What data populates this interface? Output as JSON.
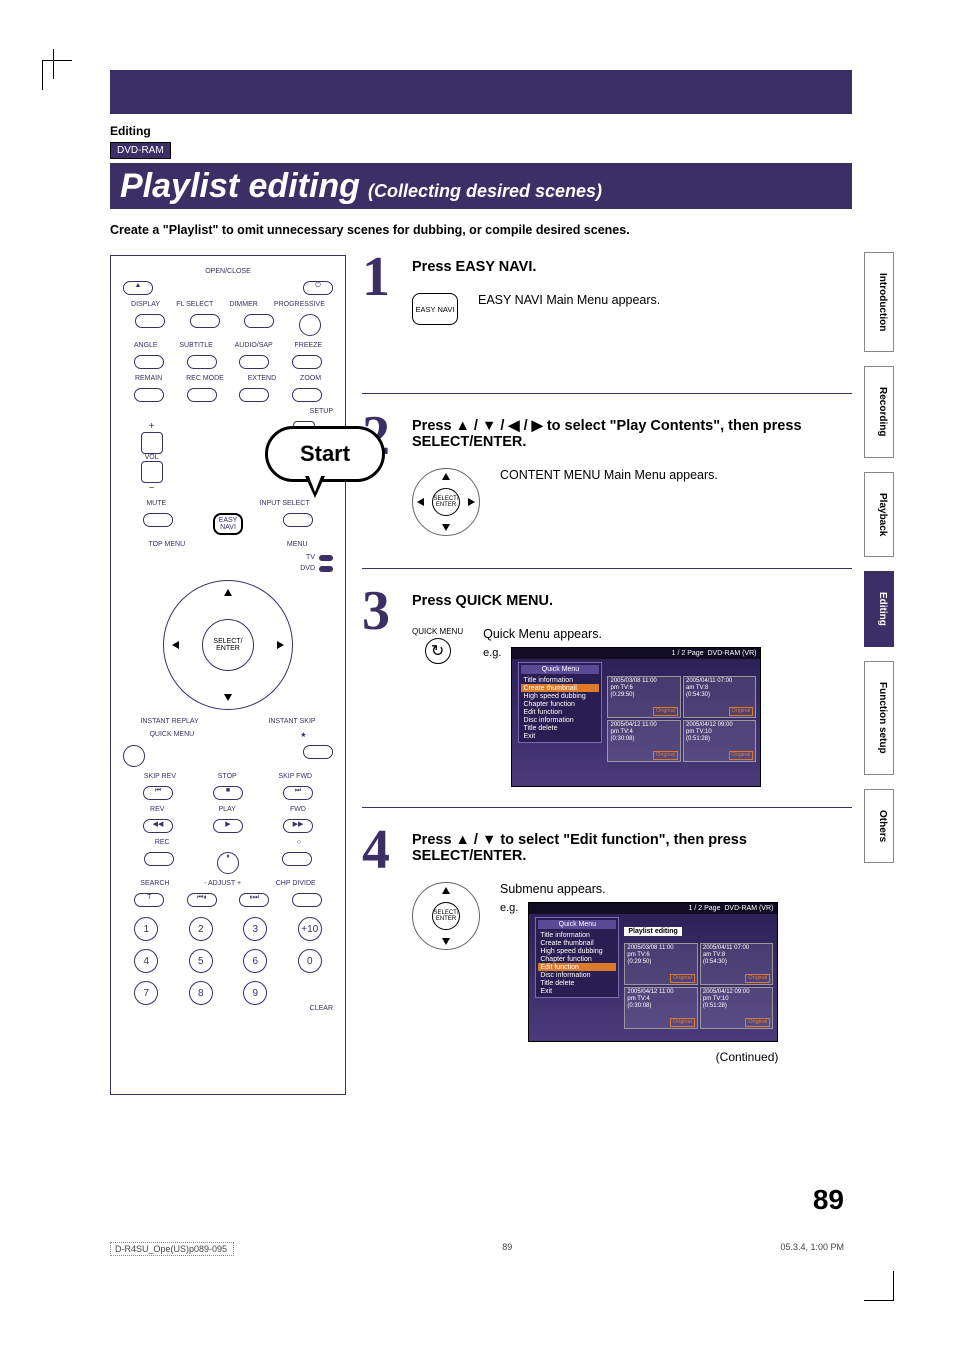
{
  "header": {
    "section": "Editing",
    "disc_type": "DVD-RAM",
    "title": "Playlist editing",
    "subtitle": "(Collecting desired scenes)",
    "lead": "Create a \"Playlist\" to omit unnecessary scenes for dubbing, or compile desired scenes."
  },
  "remote": {
    "open_close": "OPEN/CLOSE",
    "power_icon": "⏻",
    "row2": [
      "DISPLAY",
      "FL SELECT",
      "DIMMER",
      "PROGRESSIVE"
    ],
    "row3": [
      "ANGLE",
      "SUBTITLE",
      "AUDIO/SAP",
      "FREEZE"
    ],
    "row4": [
      "REMAIN",
      "REC MODE",
      "EXTEND",
      "ZOOM"
    ],
    "setup": "SETUP",
    "vol": "VOL",
    "mute": "MUTE",
    "input_select": "INPUT SELECT",
    "top_menu": "TOP MENU",
    "easy_navi": "EASY NAVI",
    "menu": "MENU",
    "tv": "TV",
    "dvd": "DVD",
    "select_enter": "SELECT/\nENTER",
    "instant_replay": "INSTANT REPLAY",
    "instant_skip": "INSTANT SKIP",
    "quick_menu": "QUICK MENU",
    "skip_rev": "SKIP REV",
    "stop": "STOP",
    "skip_fwd": "SKIP FWD",
    "rev": "REV",
    "play": "PLAY",
    "fwd": "FWD",
    "rec": "REC",
    "pause": "⏸",
    "circle_btn": "○",
    "search": "SEARCH",
    "adjust": "- ADJUST +",
    "chp_divide": "CHP DIVIDE",
    "t_btn": "T",
    "clear": "CLEAR",
    "numbers": [
      "1",
      "2",
      "3",
      "+10",
      "4",
      "5",
      "6",
      "0",
      "7",
      "8",
      "9",
      ""
    ],
    "start": "Start"
  },
  "steps": [
    {
      "num": "1",
      "title": "Press EASY NAVI.",
      "desc": "EASY NAVI Main Menu appears.",
      "btn": "EASY NAVI"
    },
    {
      "num": "2",
      "title": "Press ▲ / ▼ / ◀ / ▶ to select \"Play Contents\", then press SELECT/ENTER.",
      "desc": "CONTENT MENU Main Menu appears.",
      "btn": "SELECT/ ENTER"
    },
    {
      "num": "3",
      "title": "Press QUICK MENU.",
      "desc": "Quick Menu appears.",
      "eg": "e.g.",
      "qm_label": "QUICK MENU"
    },
    {
      "num": "4",
      "title": "Press ▲ / ▼ to select \"Edit function\", then press SELECT/ENTER.",
      "desc": "Submenu appears.",
      "eg": "e.g.",
      "btn": "SELECT/ ENTER"
    }
  ],
  "screen": {
    "quick_menu_hdr": "Quick Menu",
    "page": "1 / 2  Page",
    "disc_label": "DVD-RAM (VR)",
    "submenu_label": "Playlist editing",
    "menu_items": [
      "Title information",
      "Create thumbnail",
      "High speed dubbing",
      "Chapter function",
      "Edit function",
      "Disc information",
      "Title delete",
      "Exit"
    ],
    "orig": "Original",
    "thumbs": [
      {
        "date": "2005/03/08 11:00",
        "ch": "pm  TV:6",
        "dur": "(0:29:50)"
      },
      {
        "date": "2005/04/11 07:00",
        "ch": "am  TV:8",
        "dur": "(0:54:30)"
      },
      {
        "date": "2005/04/12 11:00",
        "ch": "pm  TV:4",
        "dur": "(0:30:08)"
      },
      {
        "date": "2005/04/12 09:00",
        "ch": "pm  TV:10",
        "dur": "(0:51:28)"
      }
    ]
  },
  "continued": "(Continued)",
  "page_number": "89",
  "footer": {
    "file": "D-R4SU_Ope(US)p089-095",
    "page": "89",
    "date": "05.3.4, 1:00 PM"
  },
  "tabs": [
    "Introduction",
    "Recording",
    "Playback",
    "Editing",
    "Function setup",
    "Others"
  ],
  "active_tab": "Editing"
}
